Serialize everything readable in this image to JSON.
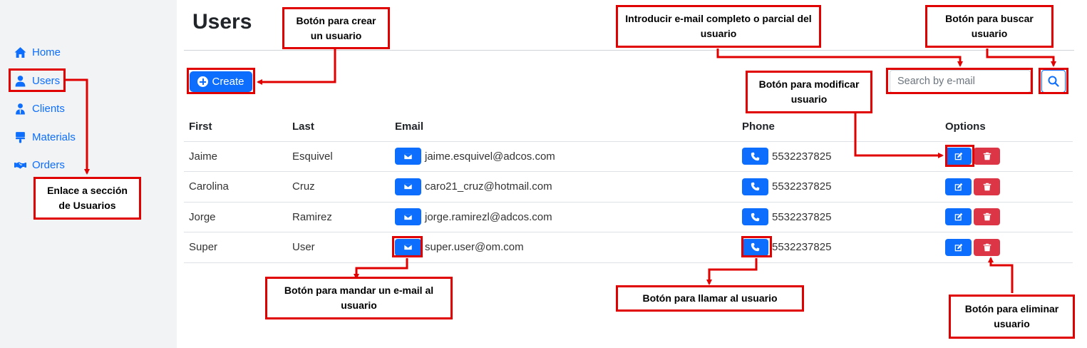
{
  "sidebar": {
    "items": [
      {
        "label": "Home",
        "icon": "home-icon"
      },
      {
        "label": "Users",
        "icon": "user-icon"
      },
      {
        "label": "Clients",
        "icon": "clients-icon"
      },
      {
        "label": "Materials",
        "icon": "paint-brush-icon"
      },
      {
        "label": "Orders",
        "icon": "handshake-icon"
      }
    ]
  },
  "main": {
    "title": "Users",
    "create_label": "Create",
    "search": {
      "placeholder": "Search by e-mail"
    },
    "table": {
      "headers": [
        "First",
        "Last",
        "Email",
        "Phone",
        "Options"
      ],
      "rows": [
        {
          "first": "Jaime",
          "last": "Esquivel",
          "email": "jaime.esquivel@adcos.com",
          "phone": "5532237825"
        },
        {
          "first": "Carolina",
          "last": "Cruz",
          "email": "caro21_cruz@hotmail.com",
          "phone": "5532237825"
        },
        {
          "first": "Jorge",
          "last": "Ramirez",
          "email": "jorge.ramirezl@adcos.com",
          "phone": "5532237825"
        },
        {
          "first": "Super",
          "last": "User",
          "email": "super.user@om.com",
          "phone": "5532237825"
        }
      ]
    }
  },
  "annotations": {
    "create": "Botón para crear un usuario",
    "search_input": "Introducir e-mail completo o parcial del usuario",
    "search_button": "Botón para buscar usuario",
    "modify": "Botón para modificar usuario",
    "users_link": "Enlace a sección de Usuarios",
    "email": "Botón para mandar un e-mail al usuario",
    "call": "Botón para llamar al usuario",
    "delete": "Botón para eliminar usuario"
  },
  "colors": {
    "primary": "#0d6efd",
    "danger": "#dc3545",
    "annotation": "#e00000",
    "sidebar_bg": "#f1f3f5"
  }
}
